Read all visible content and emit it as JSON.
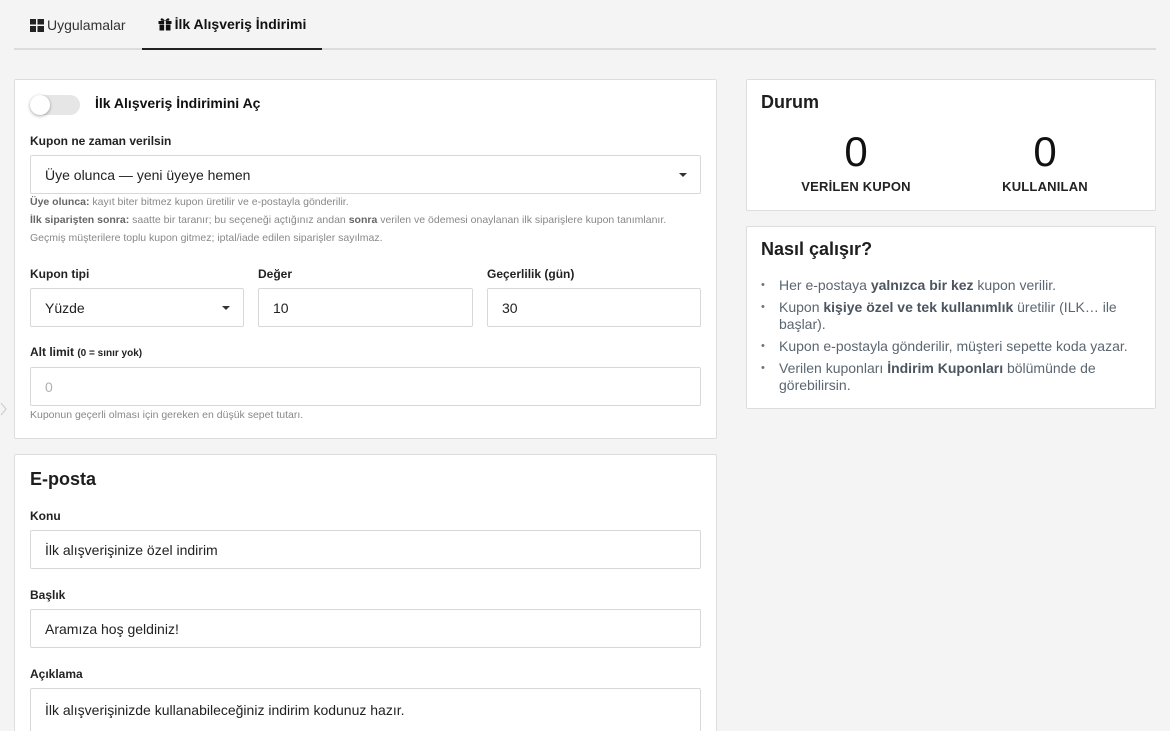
{
  "tabs": [
    {
      "label": "Uygulamalar",
      "icon": "grid-icon",
      "active": false
    },
    {
      "label": "İlk Alışveriş İndirimi",
      "icon": "gift-icon",
      "active": true
    }
  ],
  "settings": {
    "toggle_label": "İlk Alışveriş İndirimini Aç",
    "toggle_on": false,
    "when_label": "Kupon ne zaman verilsin",
    "when_value": "Üye olunca — yeni üyeye hemen",
    "help": {
      "line1_bold": "Üye olunca:",
      "line1_text": " kayıt biter bitmez kupon üretilir ve e-postayla gönderilir.",
      "line2_bold": "İlk siparişten sonra:",
      "line2_text_a": " saatte bir taranır; bu seçeneği açtığınız andan ",
      "line2_bold2": "sonra",
      "line2_text_b": " verilen ve ödemesi onaylanan ilk siparişlere kupon tanımlanır.",
      "line3": "Geçmiş müşterilere toplu kupon gitmez; iptal/iade edilen siparişler sayılmaz."
    },
    "type_label": "Kupon tipi",
    "type_value": "Yüzde",
    "value_label": "Değer",
    "value_value": "10",
    "validity_label": "Geçerlilik (gün)",
    "validity_value": "30",
    "min_label": "Alt limit",
    "min_label_sub": "(0 = sınır yok)",
    "min_placeholder": "0",
    "min_help": "Kuponun geçerli olması için gereken en düşük sepet tutarı."
  },
  "email": {
    "title": "E-posta",
    "subject_label": "Konu",
    "subject_value": "İlk alışverişinize özel indirim",
    "heading_label": "Başlık",
    "heading_value": "Aramıza hoş geldiniz!",
    "desc_label": "Açıklama",
    "desc_value": "İlk alışverişinizde kullanabileceğiniz indirim kodunuz hazır."
  },
  "status": {
    "title": "Durum",
    "issued_count": "0",
    "issued_label": "VERİLEN KUPON",
    "used_count": "0",
    "used_label": "KULLANILAN"
  },
  "how": {
    "title": "Nasıl çalışır?",
    "items": [
      {
        "a": "Her e-postaya ",
        "b": "yalnızca bir kez",
        "c": " kupon verilir."
      },
      {
        "a": "Kupon ",
        "b": "kişiye özel ve tek kullanımlık",
        "c": " üretilir (ILK… ile başlar)."
      },
      {
        "a": "Kupon e-postayla gönderilir, müşteri sepette koda yazar.",
        "b": "",
        "c": ""
      },
      {
        "a": "Verilen kuponları ",
        "b": "İndirim Kuponları",
        "c": " bölümünde de görebilirsin."
      }
    ]
  },
  "colors": {
    "background": "#f4f4f4",
    "panel": "#ffffff",
    "border": "#dddddd",
    "muted_text": "#888888",
    "toggle_off": "#e6e6e6"
  }
}
